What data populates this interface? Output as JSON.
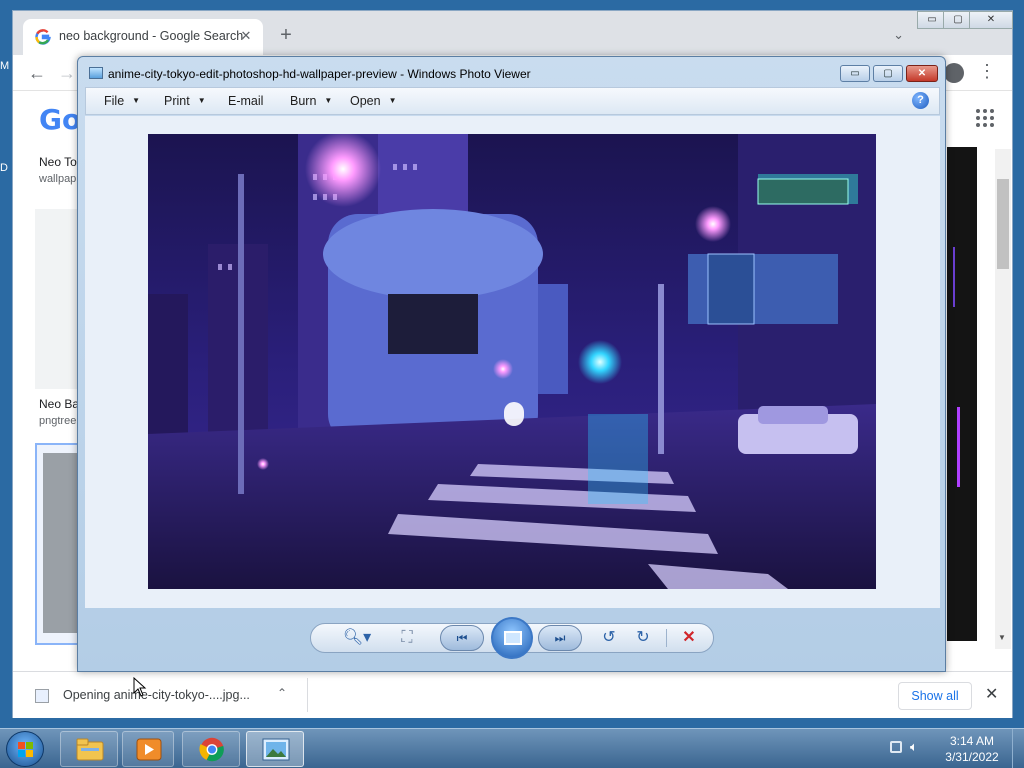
{
  "desktop": {
    "edge_letters": [
      "M",
      "D"
    ]
  },
  "chrome": {
    "tab": {
      "title": "neo background - Google Search",
      "close_glyph": "✕"
    },
    "new_tab_glyph": "+",
    "tab_search_glyph": "⌄",
    "window_controls": {
      "minimize": "▭",
      "maximize": "▢",
      "close": "✕"
    },
    "nav": {
      "back": "←",
      "forward": "→"
    },
    "menu_glyph": "⋮",
    "google_logo": "Go",
    "results": [
      {
        "title": "Neo To",
        "source": "wallpap"
      },
      {
        "title": "Neo Ba",
        "source": "pngtree"
      }
    ],
    "scroll_arrows": {
      "up": "▲",
      "down": "▼",
      "left": "◀",
      "right": "▶"
    },
    "downloads": {
      "file_text": "Opening anime-city-tokyo-....jpg...",
      "chevron": "⌃",
      "show_all": "Show all",
      "close_glyph": "✕"
    }
  },
  "photo_viewer": {
    "title": "anime-city-tokyo-edit-photoshop-hd-wallpaper-preview - Windows Photo Viewer",
    "window_controls": {
      "minimize": "▭",
      "maximize": "▢",
      "close": "✕"
    },
    "menu": [
      {
        "label": "File",
        "has_dropdown": true
      },
      {
        "label": "Print",
        "has_dropdown": true
      },
      {
        "label": "E-mail",
        "has_dropdown": false
      },
      {
        "label": "Burn",
        "has_dropdown": true
      },
      {
        "label": "Open",
        "has_dropdown": true
      }
    ],
    "menu_caret": "▼",
    "help_glyph": "?",
    "controls": {
      "zoom": "🔍︎▾",
      "actual_size": "⛶",
      "previous": "⏮",
      "next": "⏭",
      "rotate_ccw": "↺",
      "rotate_cw": "↻",
      "delete": "✕"
    }
  },
  "taskbar": {
    "clock": {
      "time": "3:14 AM",
      "date": "3/31/2022"
    },
    "tray": {
      "network_icon": "network-icon",
      "volume_icon": "volume-icon",
      "volume_glyph": "🔈︎"
    },
    "pinned": [
      "explorer",
      "media-player",
      "chrome",
      "photo-viewer"
    ]
  },
  "colors": {
    "taskbar": "#3a6590",
    "viewer_frame": "#c9dcef",
    "close_red": "#c4392a",
    "link_blue": "#1a73e8",
    "accent_purple": "#b040ff"
  }
}
